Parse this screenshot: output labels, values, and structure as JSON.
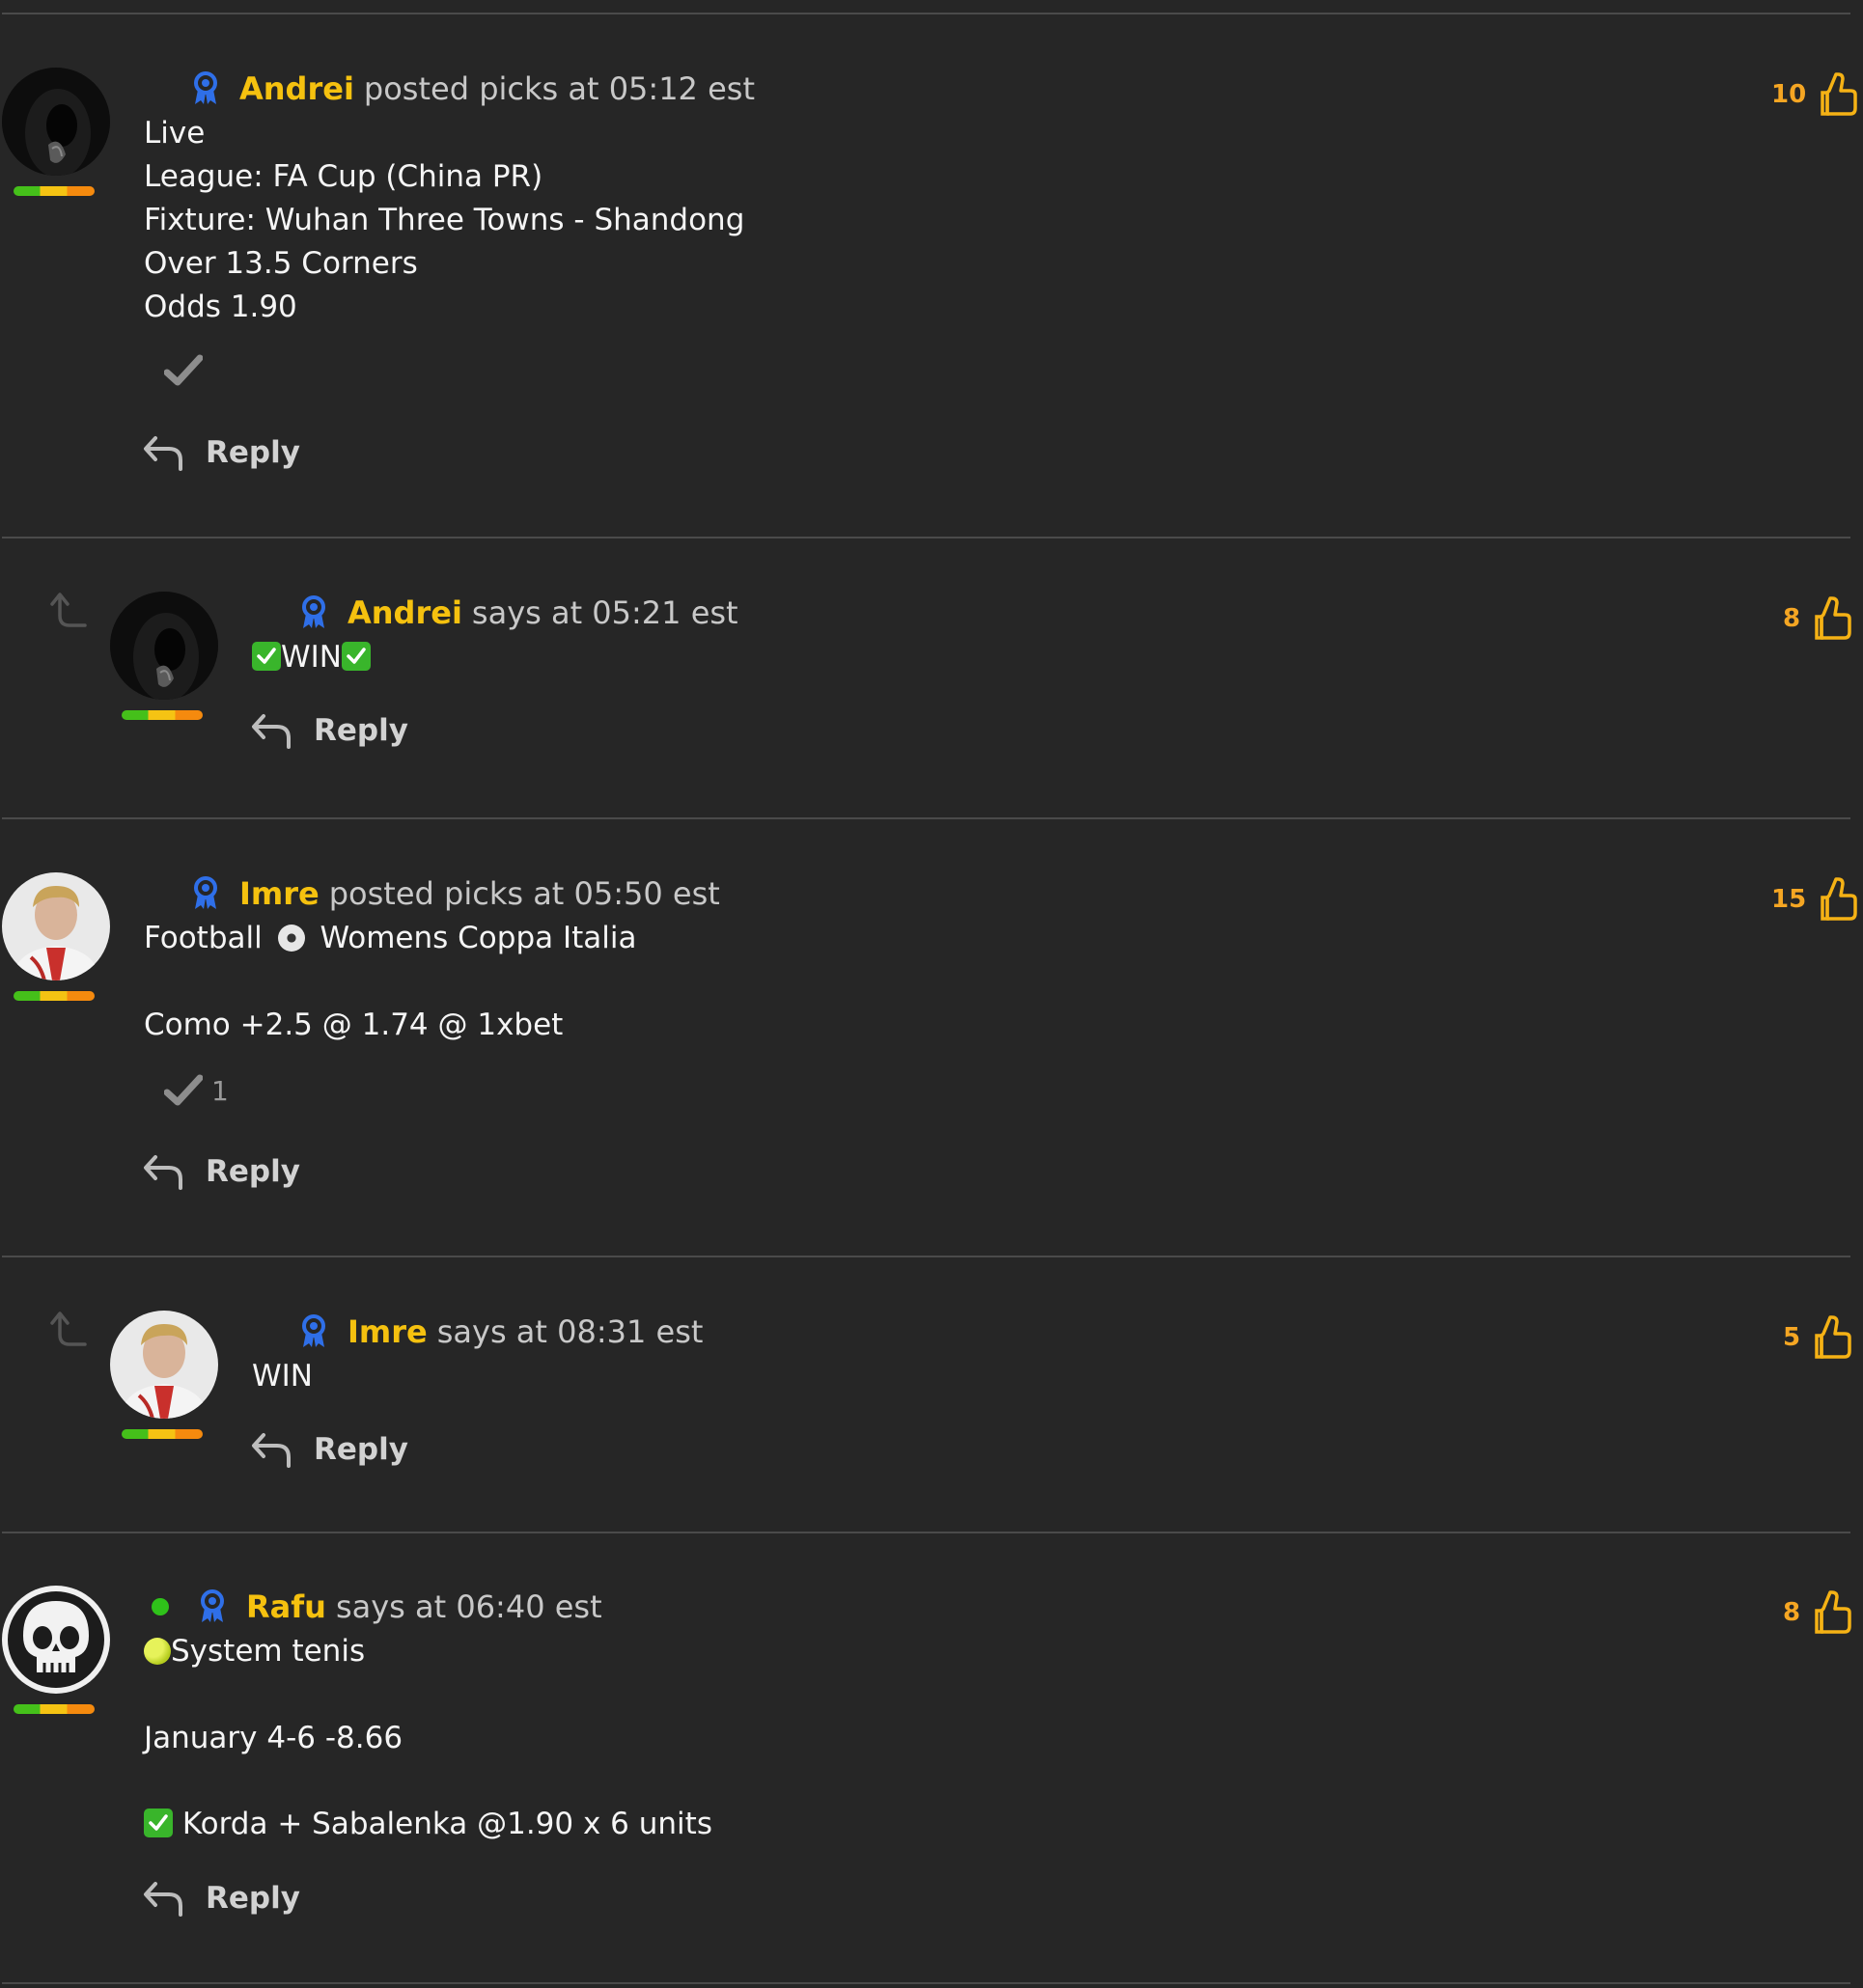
{
  "colors": {
    "background": "#262626",
    "author": "#f5c10f",
    "vote_count": "#f5a623",
    "divider": "#4a4a4a",
    "online": "#2fc21a",
    "rank_bar": [
      "#45c01a",
      "#f5c313",
      "#f58a0e"
    ]
  },
  "icons": {
    "badge": "award-ribbon-icon",
    "like": "thumbs-up-icon",
    "reply": "reply-arrow-icon",
    "nested": "corner-up-arrow-icon",
    "check": "checkmark-icon"
  },
  "comments": [
    {
      "author": "Andrei",
      "action": "posted picks at 05:12 est",
      "votes": "10",
      "lines": [
        "Live",
        "League: FA Cup (China PR)",
        "Fixture: Wuhan Three Towns - Shandong",
        "Over 13.5 Corners",
        "Odds 1.90"
      ],
      "reply_label": "Reply"
    },
    {
      "author": "Andrei",
      "action": "says at 05:21 est",
      "votes": "8",
      "lines": [
        "WIN"
      ],
      "reply_label": "Reply"
    },
    {
      "author": "Imre",
      "action": "posted picks at 05:50 est",
      "votes": "15",
      "lines": [
        "Football",
        "Womens Coppa Italia",
        "Como +2.5 @ 1.74 @ 1xbet"
      ],
      "check_count": "1",
      "reply_label": "Reply"
    },
    {
      "author": "Imre",
      "action": "says at 08:31 est",
      "votes": "5",
      "lines": [
        "WIN"
      ],
      "reply_label": "Reply"
    },
    {
      "author": "Rafu",
      "action": "says at 06:40 est",
      "votes": "8",
      "lines": [
        "System tenis",
        "January 4-6 -8.66",
        "Korda + Sabalenka @1.90 x 6 units"
      ],
      "reply_label": "Reply"
    }
  ]
}
